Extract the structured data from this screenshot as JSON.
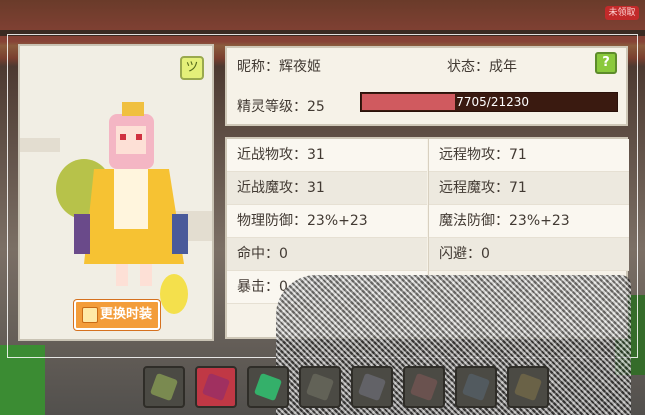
{
  "top_button": {
    "label": "未领取"
  },
  "character": {
    "nickname_label": "昵称：",
    "nickname": "辉夜姬",
    "state_label": "状态：",
    "state": "成年",
    "level_label": "精灵等级：",
    "level": "25",
    "exp_text": "7705/21230",
    "exp_fraction": 0.363,
    "change_skin_label": "更换时装",
    "help_label": "?"
  },
  "stats": {
    "left": [
      {
        "label": "近战物攻：",
        "value": "31"
      },
      {
        "label": "近战魔攻：",
        "value": "31"
      },
      {
        "label": "物理防御：",
        "value": "23%+23"
      },
      {
        "label": "命中：",
        "value": "0"
      },
      {
        "label": "暴击：",
        "value": "0"
      }
    ],
    "right": [
      {
        "label": "远程物攻：",
        "value": "71"
      },
      {
        "label": "远程魔攻：",
        "value": "71"
      },
      {
        "label": "魔法防御：",
        "value": "23%+23"
      },
      {
        "label": "闪避：",
        "value": "0"
      }
    ]
  },
  "hotbar": {
    "slot_icons": [
      "shield-icon",
      "cloak-icon",
      "gem-icon",
      "star-icon",
      "armor-icon",
      "bow-icon",
      "arrow-icon",
      "block-icon"
    ],
    "selected_index": 1
  },
  "colors": {
    "exp_fill": "#d05a5f",
    "exp_bg": "#3a1a10",
    "accent_button": "#f39d3a",
    "help_button": "#8ac93c"
  }
}
